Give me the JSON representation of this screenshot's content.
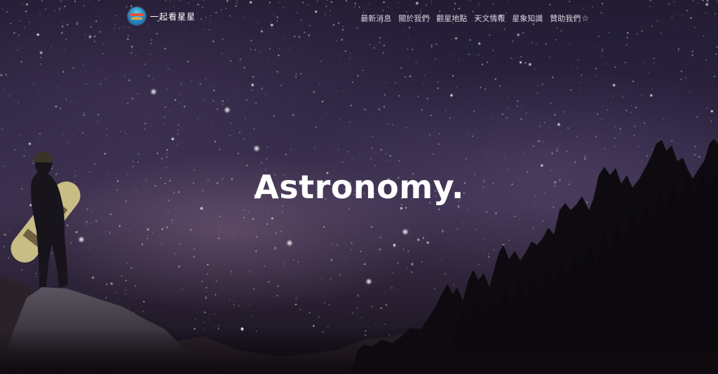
{
  "header": {
    "logo": {
      "icon": "planet-logo-icon",
      "text": "一起看星星"
    },
    "nav": [
      {
        "label": "最新消息"
      },
      {
        "label": "關於我們"
      },
      {
        "label": "觀星地點"
      },
      {
        "label": "天文情報"
      },
      {
        "label": "星象知識"
      },
      {
        "label": "贊助我們",
        "icon": "star-outline-icon",
        "icon_glyph": "☆"
      }
    ]
  },
  "hero": {
    "headline": "Astronomy."
  },
  "colors": {
    "text": "#ffffff",
    "nav_text": "#d9d4de",
    "sky_top": "#221c33",
    "sky_mid": "#3a2f4c",
    "ground": "#120d14",
    "snowboard": "#c9bd86"
  }
}
